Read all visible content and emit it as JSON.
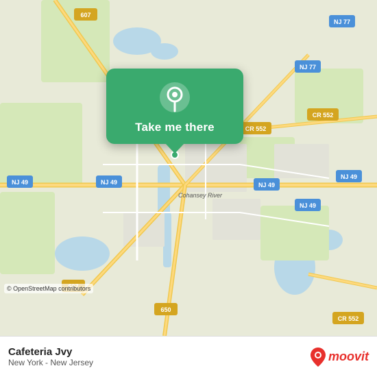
{
  "map": {
    "alt": "Map of New Jersey area showing Cafeteria Jvy location"
  },
  "popup": {
    "button_label": "Take me there"
  },
  "info_bar": {
    "location_name": "Cafeteria Jvy",
    "location_sub": "New York - New Jersey"
  },
  "attribution": {
    "text": "© OpenStreetMap contributors"
  },
  "moovit": {
    "text": "moovit"
  },
  "colors": {
    "green": "#3aaa6e",
    "map_bg": "#e8f0d8",
    "road_yellow": "#f5d76e",
    "road_white": "#ffffff",
    "water": "#b3d4e8"
  }
}
